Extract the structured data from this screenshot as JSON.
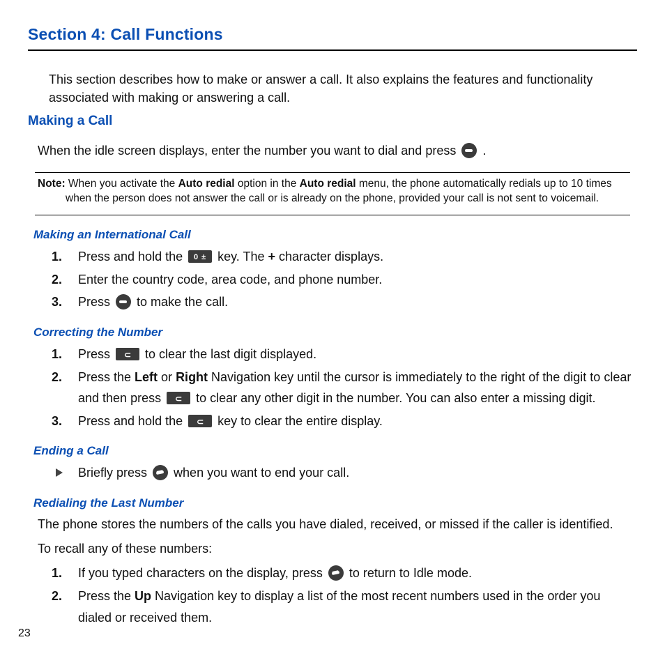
{
  "title": "Section 4: Call Functions",
  "intro": "This section describes how to make or answer a call. It also explains the features and functionality associated with making or answering a call.",
  "making_heading": "Making a Call",
  "making_text_before": "When the idle screen displays, enter the number you want to dial and press ",
  "making_text_after": ".",
  "note_label": "Note:",
  "note_text_1": "When you activate the ",
  "note_bold_1": "Auto redial",
  "note_text_2": " option in the ",
  "note_bold_2": "Auto redial",
  "note_text_3": " menu, the phone automatically redials up to 10 times when the person does not answer the call or is already on the phone, provided your call is not sent to voicemail.",
  "intl_heading": "Making an International Call",
  "intl": {
    "s1_n": "1.",
    "s1_before": "Press and hold the ",
    "s1_mid": " key. The ",
    "s1_plus": "+",
    "s1_after": " character displays.",
    "s2_n": "2.",
    "s2": "Enter the country code, area code, and phone number.",
    "s3_n": "3.",
    "s3_before": "Press ",
    "s3_after": " to make the call."
  },
  "corr_heading": "Correcting the Number",
  "corr": {
    "s1_n": "1.",
    "s1_before": "Press ",
    "s1_after": " to clear the last digit displayed.",
    "s2_n": "2.",
    "s2_a": "Press the ",
    "s2_left": "Left",
    "s2_b": " or ",
    "s2_right": "Right",
    "s2_c": " Navigation key until the cursor is immediately to the right of the digit to clear and then press ",
    "s2_d": " to clear any other digit in the number. You can also enter a missing digit.",
    "s3_n": "3.",
    "s3_before": "Press and hold the ",
    "s3_after": " key to clear the entire display."
  },
  "end_heading": "Ending a Call",
  "end_before": "Briefly press ",
  "end_after": " when you want to end your call.",
  "redial_heading": "Redialing the Last Number",
  "redial_p1": "The phone stores the numbers of the calls you have dialed, received, or missed if the caller is identified.",
  "redial_p2": "To recall any of these numbers:",
  "redial": {
    "s1_n": "1.",
    "s1_before": "If you typed characters on the display, press ",
    "s1_after": " to return to Idle mode.",
    "s2_n": "2.",
    "s2_a": "Press the ",
    "s2_up": "Up",
    "s2_b": " Navigation key to display a list of the most recent numbers used in the order you dialed or received them."
  },
  "page_number": "23"
}
